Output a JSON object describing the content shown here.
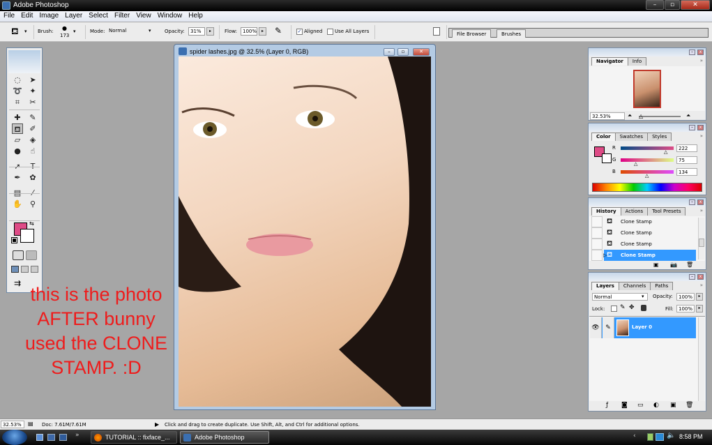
{
  "window": {
    "title": "Adobe Photoshop",
    "controls": {
      "minimize": "–",
      "restore": "▫",
      "close": "✕"
    }
  },
  "menubar": [
    "File",
    "Edit",
    "Image",
    "Layer",
    "Select",
    "Filter",
    "View",
    "Window",
    "Help"
  ],
  "options": {
    "tool_icon": "clone-stamp-icon",
    "brush_label": "Brush:",
    "brush_size": "173",
    "mode_label": "Mode:",
    "mode_value": "Normal",
    "opacity_label": "Opacity:",
    "opacity_value": "31%",
    "flow_label": "Flow:",
    "flow_value": "100%",
    "aligned_label": "Aligned",
    "aligned_checked": true,
    "use_all_layers_label": "Use All Layers",
    "use_all_layers_checked": false,
    "palette_well_tabs": [
      "File Browser",
      "Brushes"
    ]
  },
  "toolbox": {
    "tools": [
      [
        "marquee-icon",
        "move-icon"
      ],
      [
        "lasso-icon",
        "magic-wand-icon"
      ],
      [
        "crop-icon",
        "slice-icon"
      ],
      [
        "healing-brush-icon",
        "brush-icon"
      ],
      [
        "clone-stamp-icon",
        "history-brush-icon"
      ],
      [
        "eraser-icon",
        "paint-bucket-icon"
      ],
      [
        "dodge-icon",
        "smudge-icon"
      ],
      [
        "path-selection-icon",
        "type-icon"
      ],
      [
        "pen-icon",
        "custom-shape-icon"
      ],
      [
        "notes-icon",
        "eyedropper-icon"
      ],
      [
        "hand-icon",
        "zoom-icon"
      ]
    ],
    "foreground_color": "#de4b86",
    "background_color": "#ffffff"
  },
  "document": {
    "title": "spider lashes.jpg @ 32.5% (Layer 0, RGB)",
    "zoom": "32.5%"
  },
  "annotation": {
    "lines": [
      "this is the photo",
      "AFTER bunny",
      "used the CLONE",
      "STAMP. :D"
    ],
    "color": "#ee1c1c"
  },
  "navigator": {
    "tabs": [
      "Navigator",
      "Info"
    ],
    "active_tab": "Navigator",
    "zoom_value": "32.53%"
  },
  "color_panel": {
    "tabs": [
      "Color",
      "Swatches",
      "Styles"
    ],
    "active_tab": "Color",
    "channels": [
      {
        "label": "R",
        "value": "222"
      },
      {
        "label": "G",
        "value": "75"
      },
      {
        "label": "B",
        "value": "134"
      }
    ],
    "swatch": "#de4b86"
  },
  "history_panel": {
    "tabs": [
      "History",
      "Actions",
      "Tool Presets"
    ],
    "active_tab": "History",
    "items": [
      {
        "label": "Clone Stamp",
        "selected": false
      },
      {
        "label": "Clone Stamp",
        "selected": false
      },
      {
        "label": "Clone Stamp",
        "selected": false
      },
      {
        "label": "Clone Stamp",
        "selected": true
      }
    ]
  },
  "layers_panel": {
    "tabs": [
      "Layers",
      "Channels",
      "Paths"
    ],
    "active_tab": "Layers",
    "blend_mode": "Normal",
    "opacity_label": "Opacity:",
    "opacity_value": "100%",
    "lock_label": "Lock:",
    "fill_label": "Fill:",
    "fill_value": "100%",
    "layers": [
      {
        "name": "Layer 0",
        "visible": true,
        "selected": true
      }
    ]
  },
  "statusbar": {
    "zoom": "32.53%",
    "doc_info": "Doc: 7.61M/7.61M",
    "hint": "Click and drag to create duplicate.  Use Shift, Alt, and Ctrl for additional options."
  },
  "taskbar": {
    "tasks": [
      {
        "label": "TUTORIAL :: fixface_...",
        "active": false
      },
      {
        "label": "Adobe Photoshop",
        "active": true
      }
    ],
    "overflow": "»",
    "clock": "8:58 PM"
  }
}
